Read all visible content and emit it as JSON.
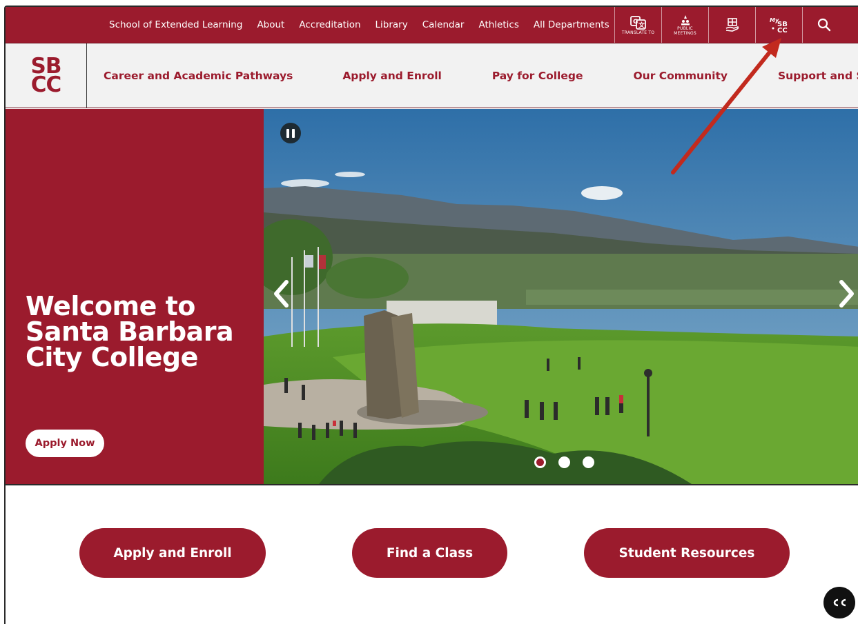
{
  "topbar": {
    "links": [
      "School of Extended Learning",
      "About",
      "Accreditation",
      "Library",
      "Calendar",
      "Athletics",
      "All Departments"
    ],
    "translate_label": "TRANSLATE TO",
    "public_label_1": "PUBLIC",
    "public_label_2": "MEETINGS"
  },
  "logo": {
    "line1": "SB",
    "line2": "CC"
  },
  "nav": {
    "items": [
      "Career and Academic Pathways",
      "Apply and Enroll",
      "Pay for College",
      "Our Community",
      "Support and Success"
    ]
  },
  "hero": {
    "title": "Welcome to Santa Barbara City College",
    "apply_button": "Apply Now",
    "slides": 3,
    "active_slide": 1
  },
  "quicklinks": {
    "apply": "Apply and Enroll",
    "find_class": "Find a Class",
    "resources": "Student Resources"
  },
  "colors": {
    "brand": "#9b1b2d",
    "annotation_arrow": "#c22a1e"
  },
  "icons": [
    "translate-icon",
    "public-meetings-icon",
    "gift-hand-icon",
    "mysbcc-icon",
    "search-icon",
    "pause-icon",
    "chevron-left-icon",
    "chevron-right-icon",
    "closed-captions-icon"
  ]
}
